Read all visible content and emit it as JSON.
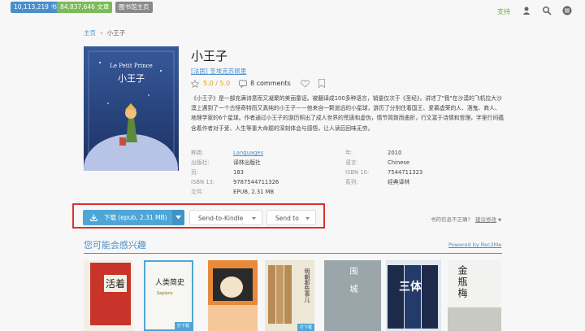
{
  "topbar": {
    "badges": [
      "10,113,219 书",
      "84,837,646 文章",
      "图书馆主页"
    ],
    "support_label": "支持"
  },
  "breadcrumb": {
    "home": "主页",
    "separator": "›",
    "current": "小王子"
  },
  "book": {
    "title": "小王子",
    "author": "[法国] 圣埃克苏佩里",
    "rating": "5.0 / 5.0",
    "comments": "8 comments",
    "description": "《小王子》是一部充满诗意而又凝聚的美丽童话。被翻译成100多种语言，销量仅次于《圣经》。讲述了\"我\"在沙漠的飞机拉大沙漠上遇到了一个古怪奇特而又真纯的小王子——他来自一颗遥远的小星球，游历了分别住着国王、爱慕虚荣的人、酒鬼、商人、地理学家的6个星球。作者通过小王子的游历照出了成人世界的荒唐和虚伪，情节简致而曲折，行文富于诗情和哲理，字里行间蕴含着作者对于爱、人生等重大命题的深刻体会与感悟，让人读后回味无穷。",
    "cover": {
      "title": "小王子",
      "subtitle": "Le Petit Prince",
      "colors": {
        "top": "#2f4f8f",
        "bottom": "#1e3566",
        "planet": "#b8c4e6"
      }
    },
    "properties_left": [
      {
        "key": "种类:",
        "value": "Languages",
        "link": true
      },
      {
        "key": "出版社:",
        "value": "译林出版社",
        "link": false
      },
      {
        "key": "页:",
        "value": "183",
        "link": false
      },
      {
        "key": "ISBN 13:",
        "value": "9787544711326",
        "link": false
      },
      {
        "key": "文件:",
        "value": "EPUB, 2.31 MB",
        "link": false
      }
    ],
    "properties_right": [
      {
        "key": "年:",
        "value": "2010"
      },
      {
        "key": "语言:",
        "value": "Chinese"
      },
      {
        "key": "ISBN 10:",
        "value": "7544711323"
      },
      {
        "key": "系列:",
        "value": "经典译林"
      }
    ]
  },
  "actions": {
    "download_label": "下载 (epub, 2.31 MB)",
    "send_kindle_label": "Send-to-Kindle",
    "send_to_label": "Send to",
    "wrong_info": "书的信息不正确?",
    "suggest_edit": "建议修改"
  },
  "recommend": {
    "title": "您可能会感兴趣",
    "powered": "Powered by Rec2Me",
    "download_tag": "打下载",
    "books": [
      {
        "title": "活着",
        "bg": "#c8342a",
        "fg": "#222"
      },
      {
        "title": "人类简史",
        "bg": "#f3f3ee",
        "fg": "#222"
      },
      {
        "title": "",
        "bg": "#e88a3a",
        "fg": "#fff"
      },
      {
        "title": "明朝那些事儿",
        "bg": "#e8e1d0",
        "fg": "#333"
      },
      {
        "title": "围城",
        "bg": "#9aa6aa",
        "fg": "#fff"
      },
      {
        "title": "三体",
        "bg": "#1d2a4a",
        "fg": "#fff"
      },
      {
        "title": "金瓶梅",
        "bg": "#f0f0f0",
        "fg": "#222"
      }
    ]
  }
}
